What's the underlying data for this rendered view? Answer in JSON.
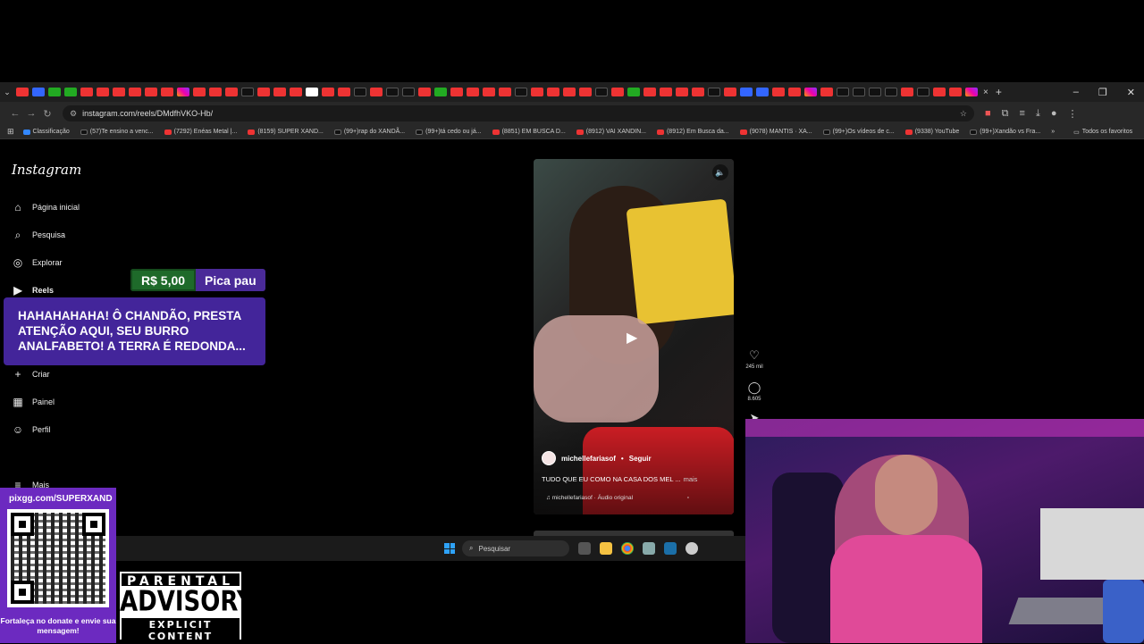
{
  "browser": {
    "tabs": [
      "yt",
      "bl",
      "gr",
      "gr",
      "yt",
      "yt",
      "yt",
      "yt",
      "yt",
      "yt",
      "ig",
      "yt",
      "yt",
      "yt",
      "tk",
      "yt",
      "yt",
      "yt",
      "sq",
      "yt",
      "yt",
      "tk",
      "yt",
      "tk",
      "tk",
      "yt",
      "gr",
      "yt",
      "yt",
      "yt",
      "yt",
      "tk",
      "yt",
      "yt",
      "yt",
      "yt",
      "tk",
      "yt",
      "gr",
      "yt",
      "yt",
      "yt",
      "yt",
      "tk",
      "yt",
      "bl",
      "bl",
      "yt",
      "yt",
      "ig",
      "yt",
      "tk",
      "tk",
      "tk",
      "tk",
      "yt",
      "tk",
      "yt",
      "yt",
      "ig"
    ],
    "url": "instagram.com/reels/DMdfhVKO-Hb/",
    "bookmarks": [
      {
        "label": "Classificação",
        "kind": "bl"
      },
      {
        "label": "(57)Te ensino a venc...",
        "kind": "tk"
      },
      {
        "label": "(7292) Enéas Metal |...",
        "kind": "yt"
      },
      {
        "label": "(8159) SUPER XAND...",
        "kind": "yt"
      },
      {
        "label": "(99+)rap do XANDÃ...",
        "kind": "tk"
      },
      {
        "label": "(99+)tá cedo ou já...",
        "kind": "tk"
      },
      {
        "label": "(8851) EM BUSCA D...",
        "kind": "yt"
      },
      {
        "label": "(8912) VAI XANDIN...",
        "kind": "yt"
      },
      {
        "label": "(8912) Em Busca da...",
        "kind": "yt"
      },
      {
        "label": "(9078) MANTIS · XA...",
        "kind": "yt"
      },
      {
        "label": "(99+)Os vídeos de c...",
        "kind": "tk"
      },
      {
        "label": "(9338) YouTube",
        "kind": "yt"
      },
      {
        "label": "(99+)Xandão vs Fra...",
        "kind": "tk"
      }
    ],
    "bookmarks_folder": "Todos os favoritos"
  },
  "instagram": {
    "logo": "Instagram",
    "nav": {
      "home": "Página inicial",
      "search": "Pesquisa",
      "explore": "Explorar",
      "reels": "Reels",
      "create": "Criar",
      "dashboard": "Painel",
      "profile": "Perfil",
      "more": "Mais"
    },
    "reel": {
      "username": "michellefariasof",
      "follow": "Seguir",
      "caption": "TUDO QUE EU COMO NA CASA DOS MEL ...",
      "caption_more": "mais",
      "audio": "michellefariasof · Áudio original",
      "likes": "245 mil",
      "comments": "8.605"
    }
  },
  "taskbar": {
    "search_placeholder": "Pesquisar"
  },
  "stream": {
    "donation_amount": "R$ 5,00",
    "donor_name": "Pica pau",
    "donation_message": "HAHAHAHAHA! Ô CHANDÃO, PRESTA ATENÇÃO AQUI, SEU BURRO ANALFABETO! A TERRA É REDONDA...",
    "qr_url": "pixgg.com/SUPERXAND",
    "qr_message": "Fortaleça no donate e envie sua mensagem!",
    "advisory_top": "PARENTAL",
    "advisory_mid": "ADVISORY",
    "advisory_bot": "EXPLICIT CONTENT"
  },
  "colors": {
    "donation_green": "#1e6a2a",
    "donation_purple": "#43259a",
    "qr_purple": "#6c2ac0"
  }
}
